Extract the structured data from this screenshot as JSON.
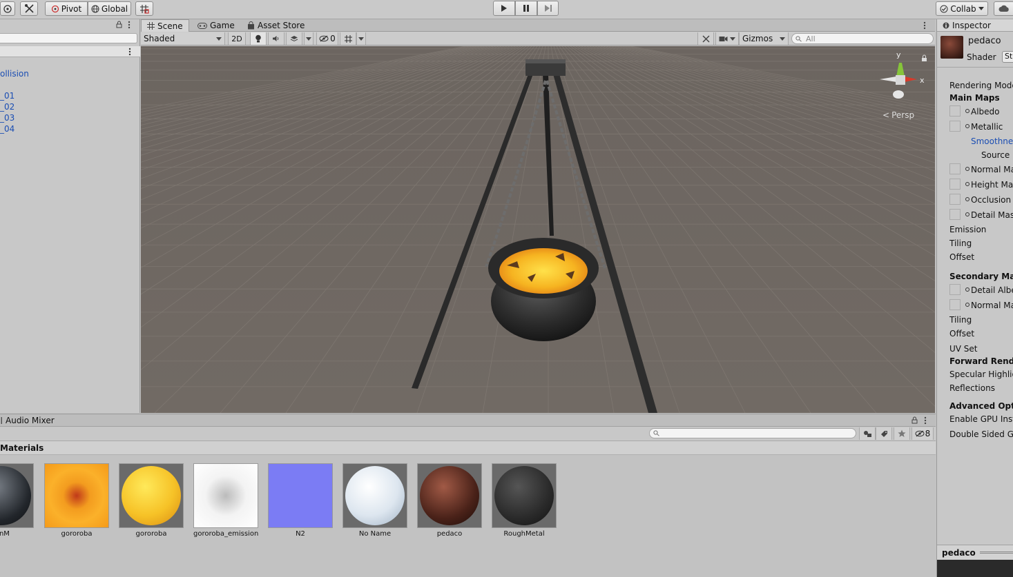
{
  "toolbar": {
    "pivot_label": "Pivot",
    "global_label": "Global",
    "collab_label": "Collab"
  },
  "hierarchy": {
    "items": [
      "ollision",
      "_01",
      "_02",
      "_03",
      "_04"
    ]
  },
  "scene": {
    "tabs": [
      {
        "label": "Scene",
        "icon": "grid-icon"
      },
      {
        "label": "Game",
        "icon": "gamepad-icon"
      },
      {
        "label": "Asset Store",
        "icon": "bag-icon"
      }
    ],
    "shading_mode": "Shaded",
    "mode_2d": "2D",
    "hidden_count": "0",
    "gizmos_label": "Gizmos",
    "search_placeholder": "All",
    "persp_label": "Persp",
    "axis_y": "y",
    "axis_x": "x"
  },
  "inspector": {
    "tab_label": "Inspector",
    "material_name": "pedaco",
    "shader_label": "Shader",
    "shader_value": "St",
    "rows": [
      {
        "label": "Rendering Mode",
        "bold": false
      },
      {
        "label": "Main Maps",
        "bold": true
      },
      {
        "label": "Albedo",
        "slot": true
      },
      {
        "label": "Metallic",
        "slot": true
      },
      {
        "label": "Smoothness",
        "link": true
      },
      {
        "label": "Source",
        "indent": true
      },
      {
        "label": "Normal Map",
        "slot": true
      },
      {
        "label": "Height Map",
        "slot": true
      },
      {
        "label": "Occlusion",
        "slot": true
      },
      {
        "label": "Detail Mask",
        "slot": true
      },
      {
        "label": "Emission"
      },
      {
        "label": "Tiling"
      },
      {
        "label": "Offset"
      },
      {
        "label": "Secondary Maps",
        "bold": true
      },
      {
        "label": "Detail Albedo",
        "slot": true
      },
      {
        "label": "Normal Map",
        "slot": true
      },
      {
        "label": "Tiling"
      },
      {
        "label": "Offset"
      },
      {
        "label": "UV Set"
      },
      {
        "label": "Forward Rendering",
        "bold": true
      },
      {
        "label": "Specular Highlights"
      },
      {
        "label": "Reflections"
      },
      {
        "label": "Advanced Options",
        "bold": true
      },
      {
        "label": "Enable GPU Instancing"
      },
      {
        "label": "Double Sided Global"
      }
    ],
    "footer_name": "pedaco"
  },
  "project": {
    "tab_label": "Audio Mixer",
    "hidden_count": "8",
    "folder_title": "Materials",
    "assets": [
      {
        "name": "ainM",
        "kind": "dark-sphere"
      },
      {
        "name": "gororoba",
        "kind": "lava-flat"
      },
      {
        "name": "gororoba",
        "kind": "lava-sphere"
      },
      {
        "name": "gororoba_emission",
        "kind": "white-flat"
      },
      {
        "name": "N2",
        "kind": "normal-flat"
      },
      {
        "name": "No Name",
        "kind": "white-sphere"
      },
      {
        "name": "pedaco",
        "kind": "brown-sphere"
      },
      {
        "name": "RoughMetal",
        "kind": "metal-sphere"
      }
    ]
  },
  "colors": {
    "viewport_bg": "#6f6862",
    "panel_bg": "#c8c8c8",
    "link_blue": "#1a4db3"
  }
}
